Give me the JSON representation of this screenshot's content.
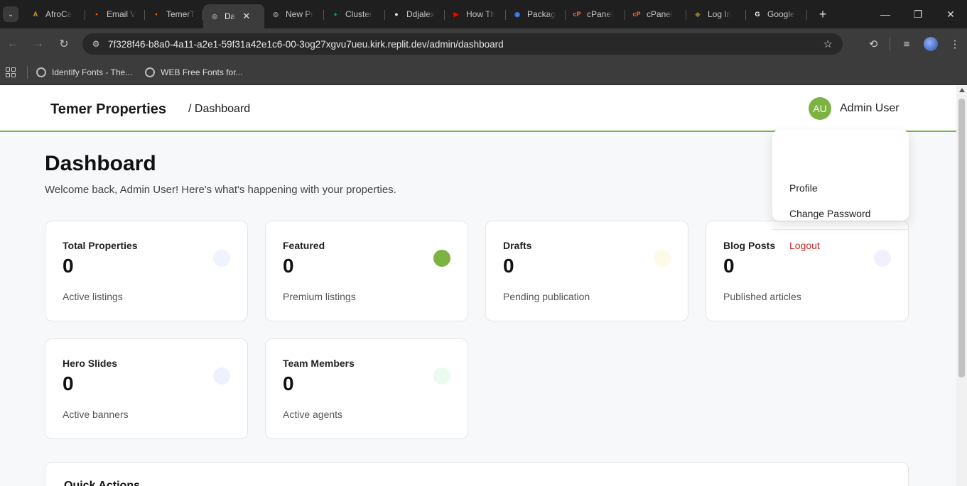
{
  "browser": {
    "tabs": [
      {
        "label": "AfroCa",
        "fav_color": "#d79b2b",
        "fav_text": "A"
      },
      {
        "label": "Email V",
        "fav_color": "#ff6a00",
        "fav_text": "▪"
      },
      {
        "label": "TemerT",
        "fav_color": "#ff6a00",
        "fav_text": "▪"
      },
      {
        "label": "Da",
        "fav_color": "#9aa0a6",
        "fav_text": "◎",
        "active": true
      },
      {
        "label": "New Pr",
        "fav_color": "#9aa0a6",
        "fav_text": "◎"
      },
      {
        "label": "Cluster",
        "fav_color": "#00a35c",
        "fav_text": "♦"
      },
      {
        "label": "Ddjalex",
        "fav_color": "#e8e8e8",
        "fav_text": "●"
      },
      {
        "label": "How Th",
        "fav_color": "#ff0000",
        "fav_text": "▶"
      },
      {
        "label": "Packag",
        "fav_color": "#4285f4",
        "fav_text": "◉"
      },
      {
        "label": "cPanel",
        "fav_color": "#ff6c2c",
        "fav_text": "cP"
      },
      {
        "label": "cPanel",
        "fav_color": "#ff6c2c",
        "fav_text": "cP"
      },
      {
        "label": "Log In",
        "fav_color": "#8a7a2a",
        "fav_text": "◆"
      },
      {
        "label": "Google",
        "fav_color": "#ffffff",
        "fav_text": "G"
      }
    ],
    "url_host": "7f328f46-b8a0-4a11-a2e1-59f31a42e1c6-00-3og27xgvu7ueu.kirk.replit.dev",
    "url_path": "/admin/dashboard",
    "bookmarks": [
      {
        "label": "Identify Fonts - The..."
      },
      {
        "label": "WEB Free Fonts for..."
      }
    ]
  },
  "header": {
    "brand": "Temer Properties",
    "breadcrumb": "/ Dashboard",
    "avatar_initials": "AU",
    "user_name": "Admin User"
  },
  "user_menu": {
    "profile": "Profile",
    "change_password": "Change Password",
    "logout": "Logout"
  },
  "main": {
    "title": "Dashboard",
    "subtitle": "Welcome back, Admin User! Here's what's happening with your properties.",
    "cards": [
      {
        "label": "Total Properties",
        "value": "0",
        "note": "Active listings",
        "dot_color": "#eef3fd"
      },
      {
        "label": "Featured",
        "value": "0",
        "note": "Premium listings",
        "dot_color": "#7cb342"
      },
      {
        "label": "Drafts",
        "value": "0",
        "note": "Pending publication",
        "dot_color": "#fdfae8"
      },
      {
        "label": "Blog Posts",
        "value": "0",
        "note": "Published articles",
        "dot_color": "#f1f0fd"
      },
      {
        "label": "Hero Slides",
        "value": "0",
        "note": "Active banners",
        "dot_color": "#eef1fd"
      },
      {
        "label": "Team Members",
        "value": "0",
        "note": "Active agents",
        "dot_color": "#eafbf2"
      }
    ],
    "bottom_card_title": "Quick Actions"
  },
  "colors": {
    "accent": "#7cb342",
    "logout": "#c62828"
  }
}
